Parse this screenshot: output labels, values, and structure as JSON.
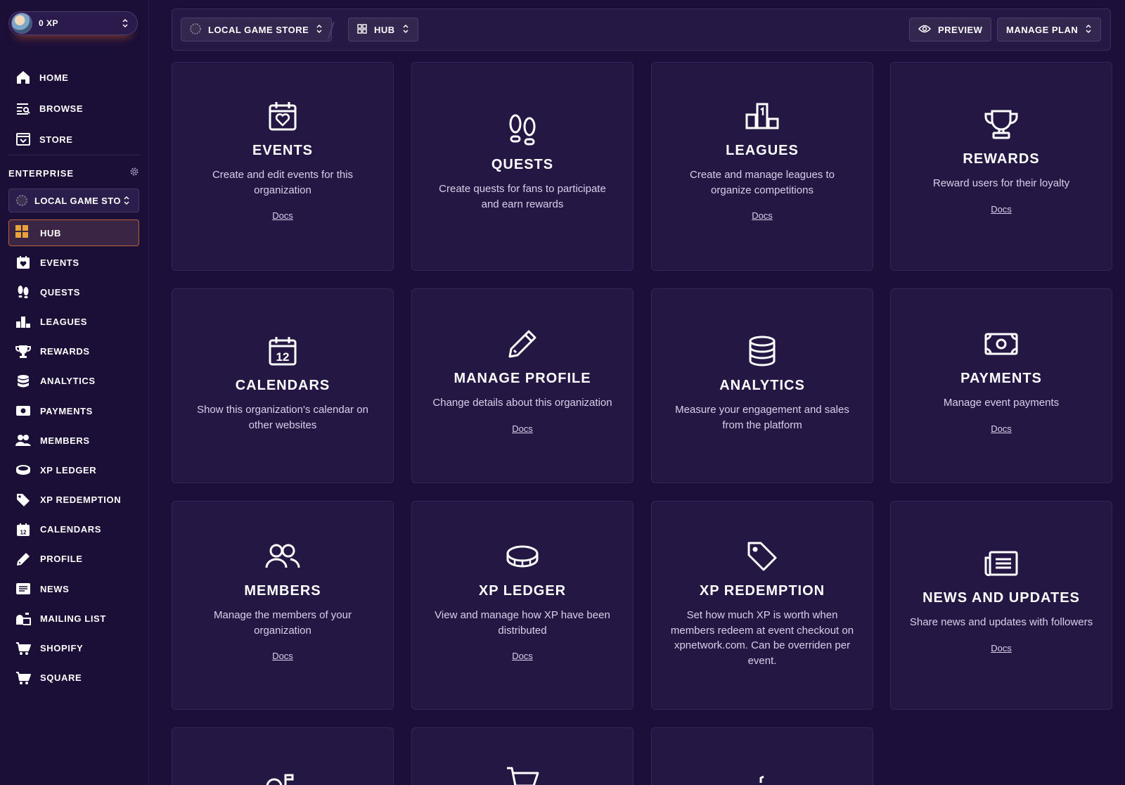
{
  "user": {
    "xp": "0 XP"
  },
  "nav_top": [
    {
      "label": "HOME",
      "icon": "home-icon"
    },
    {
      "label": "BROWSE",
      "icon": "browse-icon"
    },
    {
      "label": "STORE",
      "icon": "store-icon"
    }
  ],
  "enterprise": {
    "label": "ENTERPRISE",
    "org": "LOCAL GAME STO",
    "active": "HUB",
    "items": [
      {
        "label": "EVENTS"
      },
      {
        "label": "QUESTS"
      },
      {
        "label": "LEAGUES"
      },
      {
        "label": "REWARDS"
      },
      {
        "label": "ANALYTICS"
      },
      {
        "label": "PAYMENTS"
      },
      {
        "label": "MEMBERS"
      },
      {
        "label": "XP LEDGER"
      },
      {
        "label": "XP REDEMPTION"
      },
      {
        "label": "CALENDARS"
      },
      {
        "label": "PROFILE"
      },
      {
        "label": "NEWS"
      },
      {
        "label": "MAILING LIST"
      },
      {
        "label": "SHOPIFY"
      },
      {
        "label": "SQUARE"
      }
    ]
  },
  "topbar": {
    "org": "LOCAL GAME STORE",
    "section": "HUB",
    "preview": "PREVIEW",
    "manage_plan": "MANAGE PLAN"
  },
  "cards": [
    {
      "title": "EVENTS",
      "desc": "Create and edit events for this organization",
      "docs": "Docs"
    },
    {
      "title": "QUESTS",
      "desc": "Create quests for fans to participate and earn rewards",
      "docs": ""
    },
    {
      "title": "LEAGUES",
      "desc": "Create and manage leagues to organize competitions",
      "docs": "Docs"
    },
    {
      "title": "REWARDS",
      "desc": "Reward users for their loyalty",
      "docs": "Docs"
    },
    {
      "title": "CALENDARS",
      "desc": "Show this organization's calendar on other websites",
      "docs": ""
    },
    {
      "title": "MANAGE PROFILE",
      "desc": "Change details about this organization",
      "docs": "Docs"
    },
    {
      "title": "ANALYTICS",
      "desc": "Measure your engagement and sales from the platform",
      "docs": ""
    },
    {
      "title": "PAYMENTS",
      "desc": "Manage event payments",
      "docs": "Docs"
    },
    {
      "title": "MEMBERS",
      "desc": "Manage the members of your organization",
      "docs": "Docs"
    },
    {
      "title": "XP LEDGER",
      "desc": "View and manage how XP have been distributed",
      "docs": "Docs"
    },
    {
      "title": "XP REDEMPTION",
      "desc": "Set how much XP is worth when members redeem at event checkout on xpnetwork.com. Can be overriden per event.",
      "docs": ""
    },
    {
      "title": "NEWS AND UPDATES",
      "desc": "Share news and updates with followers",
      "docs": "Docs"
    },
    {
      "title": "",
      "desc": "",
      "docs": ""
    },
    {
      "title": "",
      "desc": "",
      "docs": ""
    },
    {
      "title": "",
      "desc": "",
      "docs": ""
    }
  ]
}
